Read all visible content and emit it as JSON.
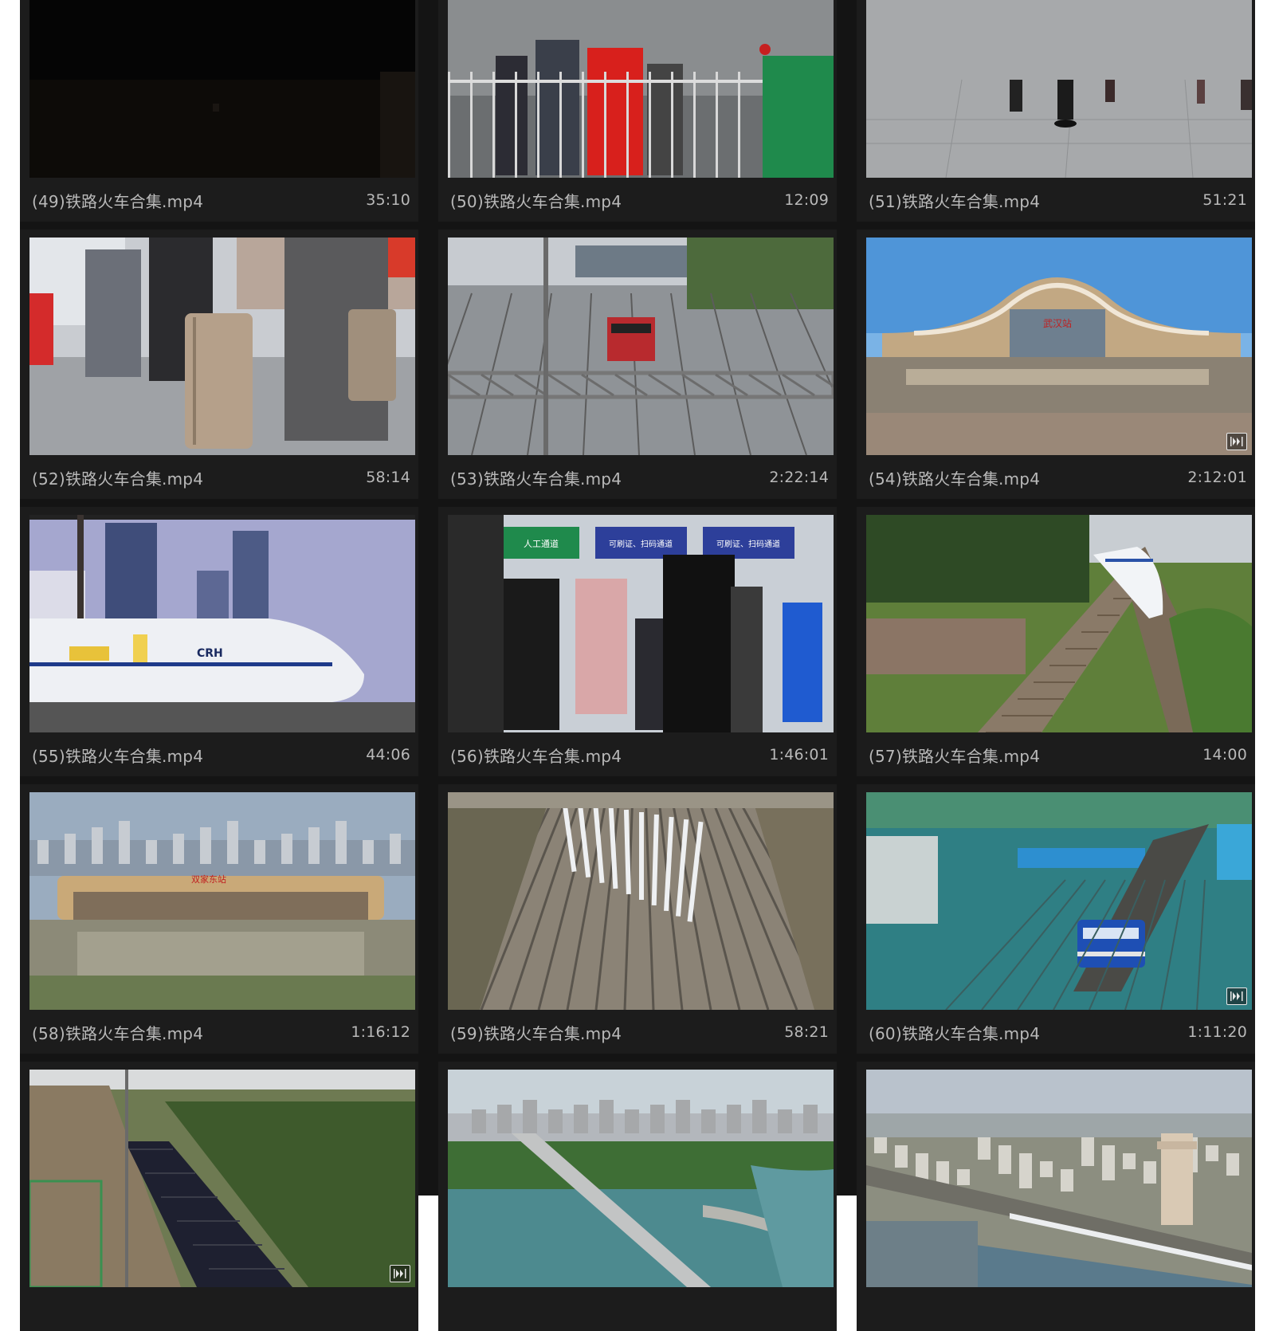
{
  "colors": {
    "panel_bg": "#141414",
    "card_bg": "#1c1c1c",
    "caption_text": "#b9b9b9"
  },
  "videos": [
    {
      "title": "(49)铁路火车合集.mp4",
      "duration": "35:10",
      "scene": "dark-night",
      "badge": false
    },
    {
      "title": "(50)铁路火车合集.mp4",
      "duration": "12:09",
      "scene": "crowd-railing",
      "badge": false
    },
    {
      "title": "(51)铁路火车合集.mp4",
      "duration": "51:21",
      "scene": "platform-feet",
      "badge": false
    },
    {
      "title": "(52)铁路火车合集.mp4",
      "duration": "58:14",
      "scene": "luggage-travelers",
      "badge": false
    },
    {
      "title": "(53)铁路火车合集.mp4",
      "duration": "2:22:14",
      "scene": "red-locomotive",
      "badge": false
    },
    {
      "title": "(54)铁路火车合集.mp4",
      "duration": "2:12:01",
      "scene": "wuhan-station",
      "badge": true
    },
    {
      "title": "(55)铁路火车合集.mp4",
      "duration": "44:06",
      "scene": "crh-train",
      "badge": false
    },
    {
      "title": "(56)铁路火车合集.mp4",
      "duration": "1:46:01",
      "scene": "station-gates",
      "badge": false
    },
    {
      "title": "(57)铁路火车合集.mp4",
      "duration": "14:00",
      "scene": "bullet-train-hills",
      "badge": false
    },
    {
      "title": "(58)铁路火车合集.mp4",
      "duration": "1:16:12",
      "scene": "station-square",
      "badge": false
    },
    {
      "title": "(59)铁路火车合集.mp4",
      "duration": "58:21",
      "scene": "train-depot",
      "badge": false
    },
    {
      "title": "(60)铁路火车合集.mp4",
      "duration": "1:11:20",
      "scene": "blue-locomotive",
      "badge": true
    },
    {
      "title": "",
      "duration": "",
      "scene": "freight-train",
      "badge": true
    },
    {
      "title": "",
      "duration": "",
      "scene": "river-bridge",
      "badge": false
    },
    {
      "title": "",
      "duration": "",
      "scene": "city-aerial",
      "badge": false
    }
  ],
  "station_signs": {
    "wuhan": "武汉站",
    "square": "双家东站",
    "crh": "CRH",
    "gate_1": "人工通道",
    "gate_2": "可刷证、扫码通道",
    "gate_3": "可刷证、扫码通道"
  },
  "badge_icon": "fast-forward-icon"
}
